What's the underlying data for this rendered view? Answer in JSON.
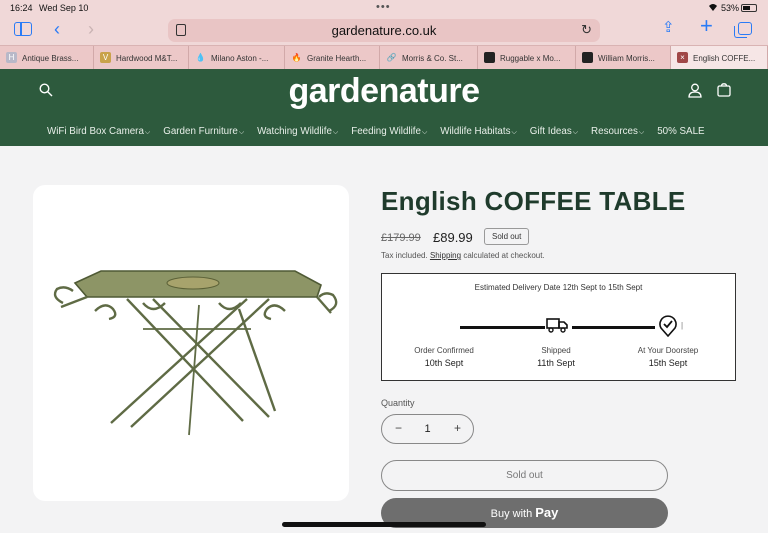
{
  "status_bar": {
    "time": "16:24",
    "date": "Wed Sep 10",
    "battery": "53%"
  },
  "browser": {
    "url": "gardenature.co.uk",
    "tabs": [
      {
        "label": "Antique Brass...",
        "favicon": "H",
        "favicon_color": "#b8b8c8"
      },
      {
        "label": "Hardwood M&T...",
        "favicon": "V",
        "favicon_color": "#c9a24a"
      },
      {
        "label": "Milano Aston -...",
        "favicon": "💧",
        "favicon_color": "#ecc8c8"
      },
      {
        "label": "Granite Hearth...",
        "favicon": "🔥",
        "favicon_color": "#ecc8c8"
      },
      {
        "label": "Morris & Co. St...",
        "favicon": "🔗",
        "favicon_color": "#ecc8c8"
      },
      {
        "label": "Ruggable x Mo...",
        "favicon": "",
        "favicon_color": "#222222"
      },
      {
        "label": "William Morris...",
        "favicon": "",
        "favicon_color": "#222222"
      },
      {
        "label": "English COFFE...",
        "favicon": "×",
        "favicon_color": "#a04848"
      }
    ]
  },
  "site": {
    "logo": "gardenature",
    "nav": [
      {
        "label": "WiFi Bird Box Camera",
        "has_dropdown": true
      },
      {
        "label": "Garden Furniture",
        "has_dropdown": true
      },
      {
        "label": "Watching Wildlife",
        "has_dropdown": true
      },
      {
        "label": "Feeding Wildlife",
        "has_dropdown": true
      },
      {
        "label": "Wildlife Habitats",
        "has_dropdown": true
      },
      {
        "label": "Gift Ideas",
        "has_dropdown": true
      },
      {
        "label": "Resources",
        "has_dropdown": true
      },
      {
        "label": "50% SALE",
        "has_dropdown": false
      }
    ],
    "colors": {
      "header_bg": "#2d5a3d",
      "title_text": "#1f3b2c"
    }
  },
  "product": {
    "title": "English COFFEE TABLE",
    "price_old": "£179.99",
    "price_new": "£89.99",
    "badge": "Sold out",
    "tax_prefix": "Tax included.",
    "tax_link": "Shipping",
    "tax_suffix": "calculated at checkout.",
    "delivery": {
      "estimate": "Estimated Delivery Date 12th Sept to 15th Sept",
      "steps": [
        {
          "label": "Order Confirmed",
          "date": "10th Sept",
          "icon": "check-icon"
        },
        {
          "label": "Shipped",
          "date": "11th Sept",
          "icon": "truck-icon"
        },
        {
          "label": "At Your Doorstep",
          "date": "15th Sept",
          "icon": "location-check-icon"
        }
      ]
    },
    "quantity_label": "Quantity",
    "quantity": "1",
    "sold_out_button": "Sold out",
    "buy_with": "Buy with",
    "apple_pay": "Pay"
  }
}
